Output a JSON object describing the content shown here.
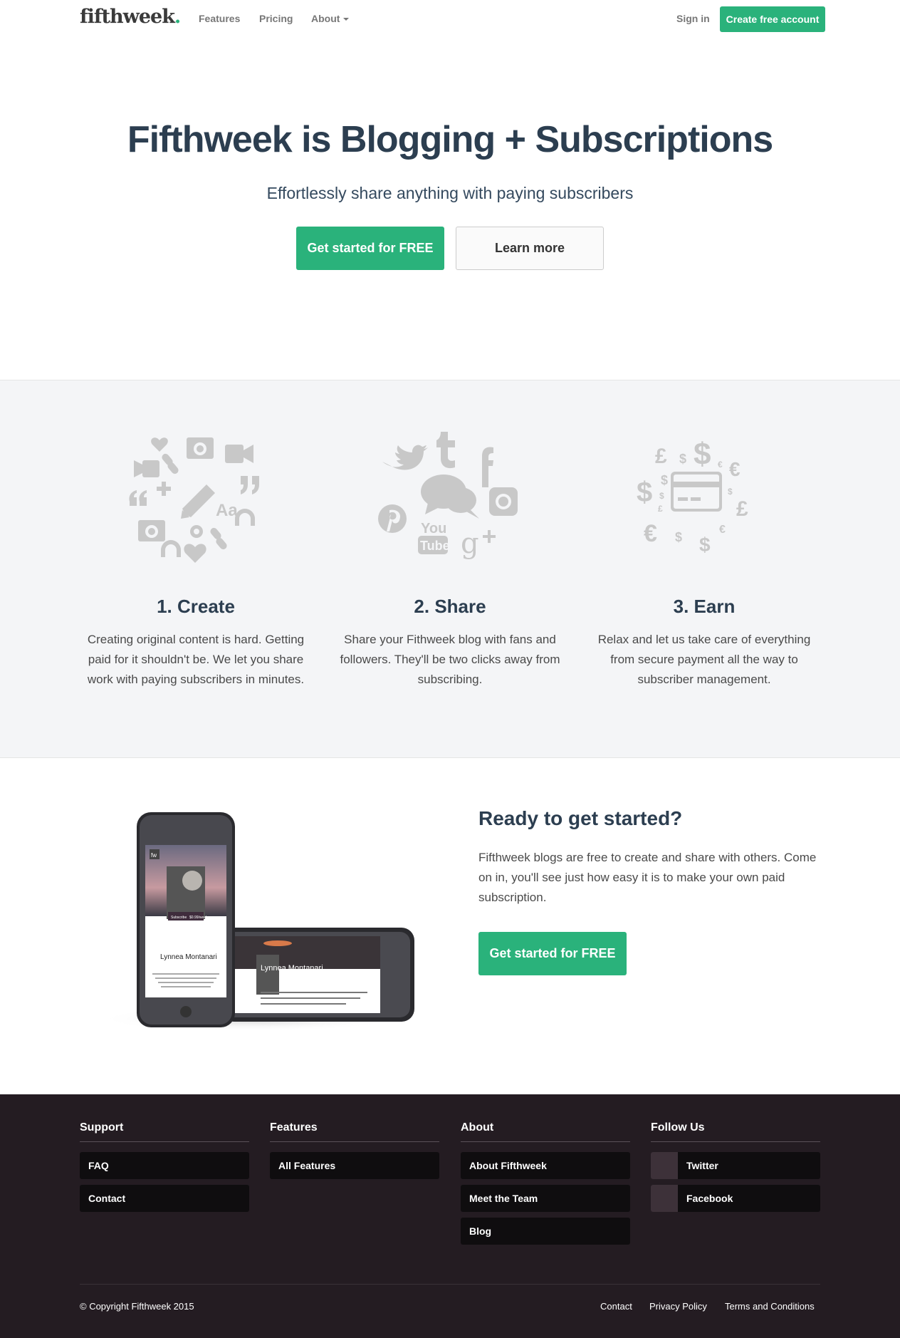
{
  "brand": {
    "logo": "fifthweek",
    "logo_dot": ".",
    "accent": "#2ab27b",
    "dark": "#2c3e50",
    "footer_bg": "#241c22"
  },
  "nav": {
    "features": "Features",
    "pricing": "Pricing",
    "about": "About",
    "sign_in": "Sign in",
    "create_account": "Create free account"
  },
  "hero": {
    "title": "Fifthweek is Blogging + Subscriptions",
    "subtitle": "Effortlessly share anything with paying subscribers",
    "primary_btn": "Get started for FREE",
    "secondary_btn": "Learn more"
  },
  "features": [
    {
      "icon": "content-types-icon",
      "title": "1.  Create",
      "text": "Creating original content is hard. Getting paid for it shouldn't be. We let you share work with paying subscribers in minutes."
    },
    {
      "icon": "social-networks-icon",
      "title": "2.  Share",
      "text": "Share your Fithweek blog with fans and followers. They'll be two clicks away from subscribing."
    },
    {
      "icon": "currencies-icon",
      "title": "3.  Earn",
      "text": "Relax and let us take care of everything from secure payment all the way to subscriber management."
    }
  ],
  "cta": {
    "title": "Ready to get started?",
    "text": "Fifthweek blogs are free to create and share with others. Come on in, you'll see just how easy it is to make your own paid subscription.",
    "button": "Get started for FREE",
    "phone": {
      "badge": "fw",
      "name": "Lynnea Montanari",
      "tagline": "Photographer, journalist, storyteller.",
      "subscribe": "Subscribe",
      "price": "$0.99/week"
    }
  },
  "footer": {
    "support": {
      "heading": "Support",
      "items": [
        "FAQ",
        "Contact"
      ]
    },
    "features": {
      "heading": "Features",
      "items": [
        "All Features"
      ]
    },
    "about": {
      "heading": "About",
      "items": [
        "About Fifthweek",
        "Meet the Team",
        "Blog"
      ]
    },
    "follow": {
      "heading": "Follow Us",
      "items": [
        "Twitter",
        "Facebook"
      ]
    },
    "copyright": "© Copyright Fifthweek 2015",
    "links": [
      "Contact",
      "Privacy Policy",
      "Terms and Conditions"
    ]
  }
}
